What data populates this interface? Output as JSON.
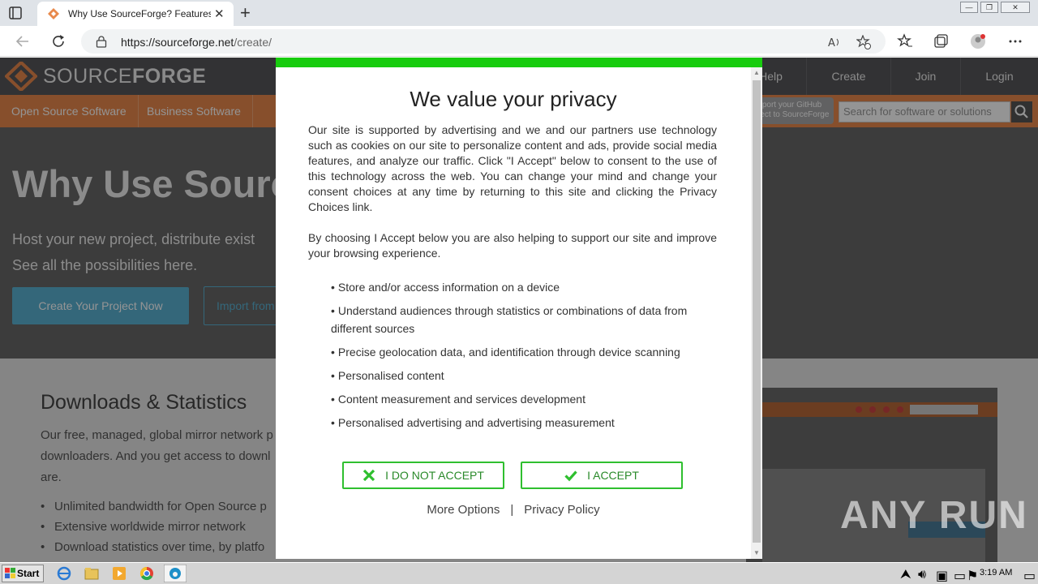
{
  "browser": {
    "tab_title": "Why Use SourceForge? Features a",
    "url_host": "https://sourceforge.net",
    "url_path": "/create/"
  },
  "site": {
    "logo_light": "SOURCE",
    "logo_bold": "FORGE",
    "topnav": [
      "Help",
      "Create",
      "Join",
      "Login"
    ],
    "subnav": [
      "Open Source Software",
      "Business Software"
    ],
    "github_import": "Import your GitHub Project to SourceForge",
    "search_placeholder": "Search for software or solutions",
    "accent_color": "#e8894c"
  },
  "hero": {
    "title": "Why Use Source",
    "subtitle": "Host your new project, distribute exist See all the possibilities here.",
    "create_button": "Create Your Project Now",
    "import_button": "Import from"
  },
  "downloads": {
    "title": "Downloads & Statistics",
    "text": "Our free, managed, global mirror network p downloaders. And you get access to downl are.",
    "bullets": [
      "Unlimited bandwidth for Open Source p",
      "Extensive worldwide mirror network",
      "Download statistics over time, by platfo"
    ]
  },
  "consent": {
    "title": "We value your privacy",
    "paragraph1": "Our site is supported by advertising and we and our partners use technology such as cookies on our site to personalize content and ads, provide social media features, and analyze our traffic. Click \"I Accept\" below to consent to the use of this technology across the web. You can change your mind and change your consent choices at any time by returning to this site and clicking the Privacy Choices link.",
    "paragraph2": "By choosing I Accept below you are also helping to support our site and improve your browsing experience.",
    "purposes": [
      "Store and/or access information on a device",
      "Understand audiences through statistics or combinations of data from different sources",
      "Precise geolocation data, and identification through device scanning",
      "Personalised content",
      "Content measurement and services development",
      "Personalised advertising and advertising measurement"
    ],
    "reject_label": "I DO NOT ACCEPT",
    "accept_label": "I ACCEPT",
    "more_options": "More Options",
    "separator": "|",
    "privacy_policy": "Privacy Policy",
    "accent_color": "#18cc0e"
  },
  "watermark": "ANY RUN",
  "taskbar": {
    "start_label": "Start",
    "clock": "3:19 AM"
  }
}
